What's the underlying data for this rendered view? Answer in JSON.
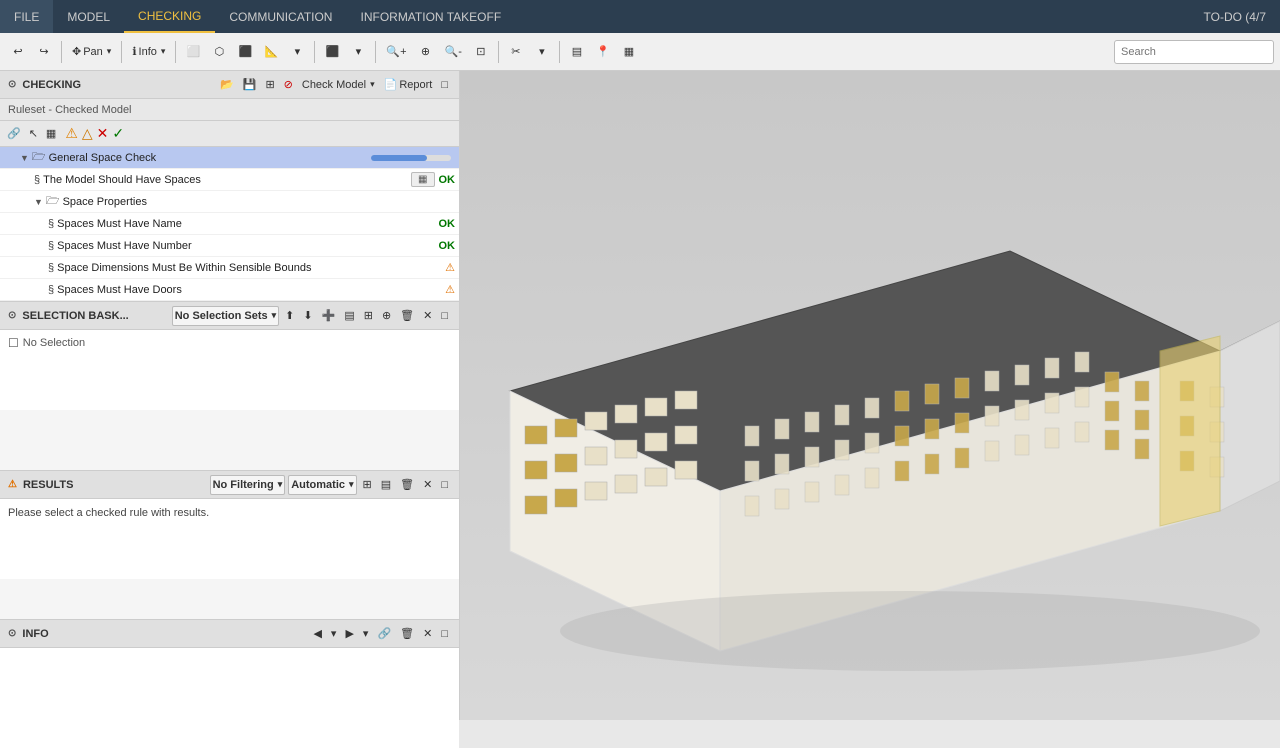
{
  "menu": {
    "items": [
      {
        "label": "FILE",
        "active": false
      },
      {
        "label": "MODEL",
        "active": false
      },
      {
        "label": "CHECKING",
        "active": true
      },
      {
        "label": "COMMUNICATION",
        "active": false
      },
      {
        "label": "INFORMATION TAKEOFF",
        "active": false
      }
    ],
    "todo": "TO-DO (4/7"
  },
  "toolbar": {
    "pan_label": "Pan",
    "info_label": "Info",
    "search_placeholder": "Search"
  },
  "checking": {
    "section_title": "CHECKING",
    "ruleset_label": "Ruleset - Checked Model",
    "check_model_label": "Check Model",
    "report_label": "Report",
    "tree_items": [
      {
        "indent": 1,
        "label": "General Space Check",
        "type": "folder",
        "expanded": true,
        "has_arrow": true,
        "icon": "folder"
      },
      {
        "indent": 2,
        "label": "The Model Should Have Spaces",
        "type": "rule",
        "badge_type": "table",
        "badge_text": "",
        "has_arrow": false,
        "icon": "rule"
      },
      {
        "indent": 2,
        "label": "Space Properties",
        "type": "folder",
        "expanded": true,
        "has_arrow": true,
        "icon": "folder"
      },
      {
        "indent": 3,
        "label": "Spaces Must Have Name",
        "type": "rule",
        "badge_type": "ok",
        "badge_text": "OK",
        "has_arrow": false,
        "icon": "rule"
      },
      {
        "indent": 3,
        "label": "Spaces Must Have Number",
        "type": "rule",
        "badge_type": "ok",
        "badge_text": "OK",
        "has_arrow": false,
        "icon": "rule"
      },
      {
        "indent": 3,
        "label": "Space Dimensions Must Be Within Sensible Bounds",
        "type": "rule",
        "badge_type": "warn",
        "badge_text": "⚠",
        "has_arrow": false,
        "icon": "rule"
      },
      {
        "indent": 3,
        "label": "Spaces Must Have Doors",
        "type": "rule",
        "badge_type": "warn",
        "badge_text": "⚠",
        "has_arrow": false,
        "icon": "rule"
      }
    ]
  },
  "selection": {
    "section_title": "SELECTION BASK...",
    "no_selection_sets": "No Selection Sets",
    "no_selection": "No Selection"
  },
  "results": {
    "section_title": "RESULTS",
    "no_filtering": "No Filtering",
    "automatic": "Automatic",
    "message": "Please select a checked rule with results."
  },
  "info": {
    "section_title": "INFO"
  },
  "viewport": {
    "label": "3D"
  },
  "icons": {
    "folder": "📁",
    "rule": "§",
    "check": "✓",
    "warn": "⚠",
    "error": "✕",
    "arrow_right": "▶",
    "arrow_down": "▼"
  }
}
